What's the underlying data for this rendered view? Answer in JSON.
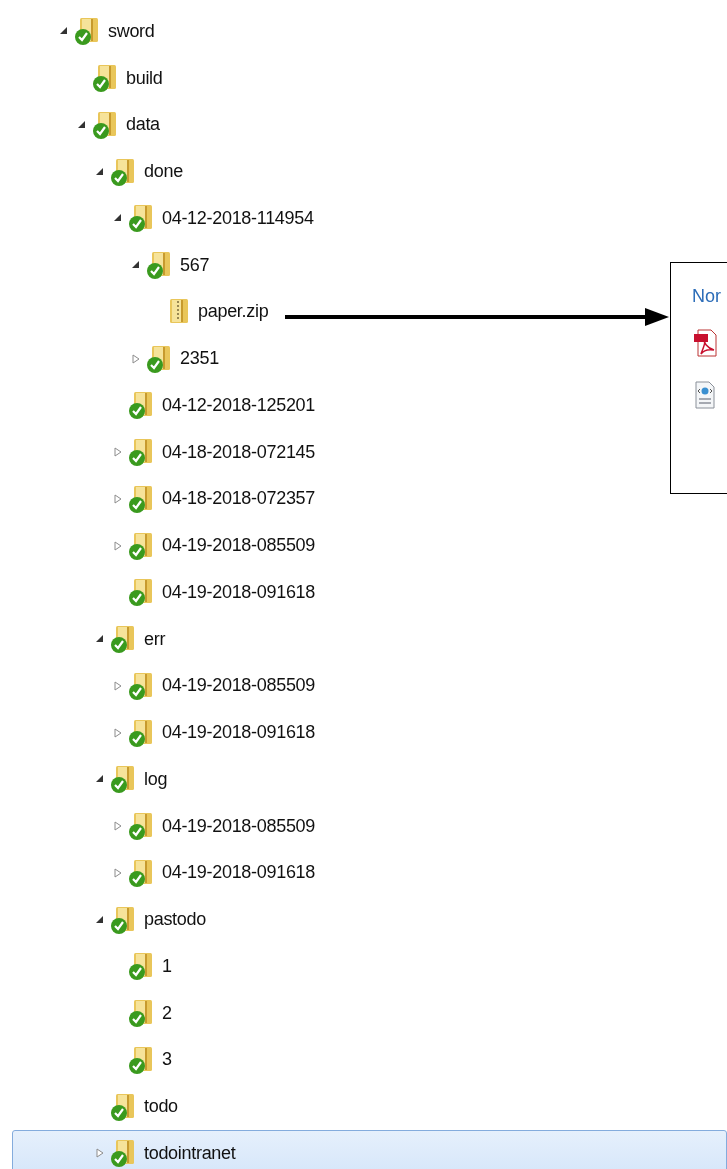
{
  "tree": [
    {
      "label": "sword",
      "kind": "folder",
      "expanded": true,
      "selected": false,
      "children": [
        {
          "label": "build",
          "kind": "folder",
          "selected": false
        },
        {
          "label": "data",
          "kind": "folder",
          "expanded": true,
          "selected": false,
          "children": [
            {
              "label": "done",
              "kind": "folder",
              "expanded": true,
              "selected": false,
              "children": [
                {
                  "label": "04-12-2018-114954",
                  "kind": "folder",
                  "expanded": true,
                  "selected": false,
                  "children": [
                    {
                      "label": "567",
                      "kind": "folder",
                      "expanded": true,
                      "selected": false,
                      "children": [
                        {
                          "label": "paper.zip",
                          "kind": "zip",
                          "selected": false
                        }
                      ]
                    },
                    {
                      "label": "2351",
                      "kind": "folder",
                      "expanded": false,
                      "selected": false
                    }
                  ]
                },
                {
                  "label": "04-12-2018-125201",
                  "kind": "folder",
                  "selected": false
                },
                {
                  "label": "04-18-2018-072145",
                  "kind": "folder",
                  "expanded": false,
                  "selected": false
                },
                {
                  "label": "04-18-2018-072357",
                  "kind": "folder",
                  "expanded": false,
                  "selected": false
                },
                {
                  "label": "04-19-2018-085509",
                  "kind": "folder",
                  "expanded": false,
                  "selected": false
                },
                {
                  "label": "04-19-2018-091618",
                  "kind": "folder",
                  "selected": false
                }
              ]
            },
            {
              "label": "err",
              "kind": "folder",
              "expanded": true,
              "selected": false,
              "children": [
                {
                  "label": "04-19-2018-085509",
                  "kind": "folder",
                  "expanded": false,
                  "selected": false
                },
                {
                  "label": "04-19-2018-091618",
                  "kind": "folder",
                  "expanded": false,
                  "selected": false
                }
              ]
            },
            {
              "label": "log",
              "kind": "folder",
              "expanded": true,
              "selected": false,
              "children": [
                {
                  "label": "04-19-2018-085509",
                  "kind": "folder",
                  "expanded": false,
                  "selected": false
                },
                {
                  "label": "04-19-2018-091618",
                  "kind": "folder",
                  "expanded": false,
                  "selected": false
                }
              ]
            },
            {
              "label": "pastodo",
              "kind": "folder",
              "expanded": true,
              "selected": false,
              "children": [
                {
                  "label": "1",
                  "kind": "folder",
                  "selected": false
                },
                {
                  "label": "2",
                  "kind": "folder",
                  "selected": false
                },
                {
                  "label": "3",
                  "kind": "folder",
                  "selected": false
                }
              ]
            },
            {
              "label": "todo",
              "kind": "folder",
              "selected": false
            },
            {
              "label": "todointranet",
              "kind": "folder",
              "expanded": false,
              "selected": true
            }
          ]
        }
      ]
    }
  ],
  "side_panel": {
    "heading": "Nor"
  }
}
